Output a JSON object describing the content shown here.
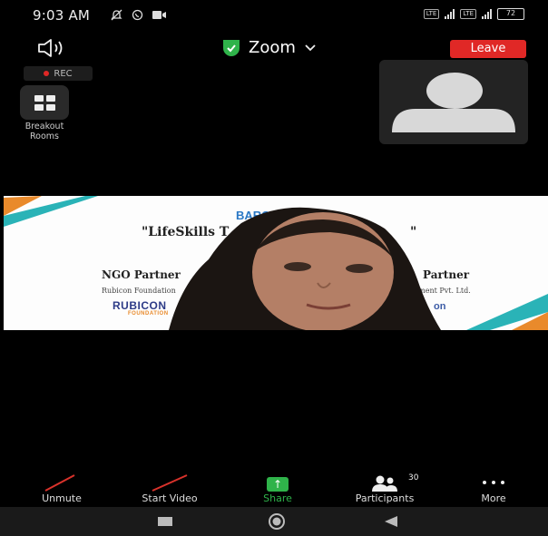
{
  "status_bar": {
    "time": "9:03 AM",
    "battery": "72"
  },
  "meeting": {
    "title": "Zoom",
    "leave_label": "Leave",
    "rec_label": "REC",
    "breakout_label": "Breakout Rooms"
  },
  "shared_slide": {
    "logo_text": "BARCL",
    "headline": "\"LifeSkills T",
    "headline_tail": "\"",
    "ngo_heading": "NGO Partner",
    "ngo_name": "Rubicon Foundation",
    "partner_heading": "Partner",
    "partner_name": "pment Pvt. Ltd.",
    "rubicon_logo": "RUBICON",
    "rubicon_sub": "FOUNDATION",
    "right_logo": "on"
  },
  "toolbar": {
    "unmute": "Unmute",
    "start_video": "Start Video",
    "share": "Share",
    "participants": "Participants",
    "participants_count": "30",
    "more": "More",
    "share_color": "#2fb34a"
  },
  "colors": {
    "leave": "#e02826",
    "shield": "#2fb34a",
    "muted_slash": "#d9322b"
  }
}
